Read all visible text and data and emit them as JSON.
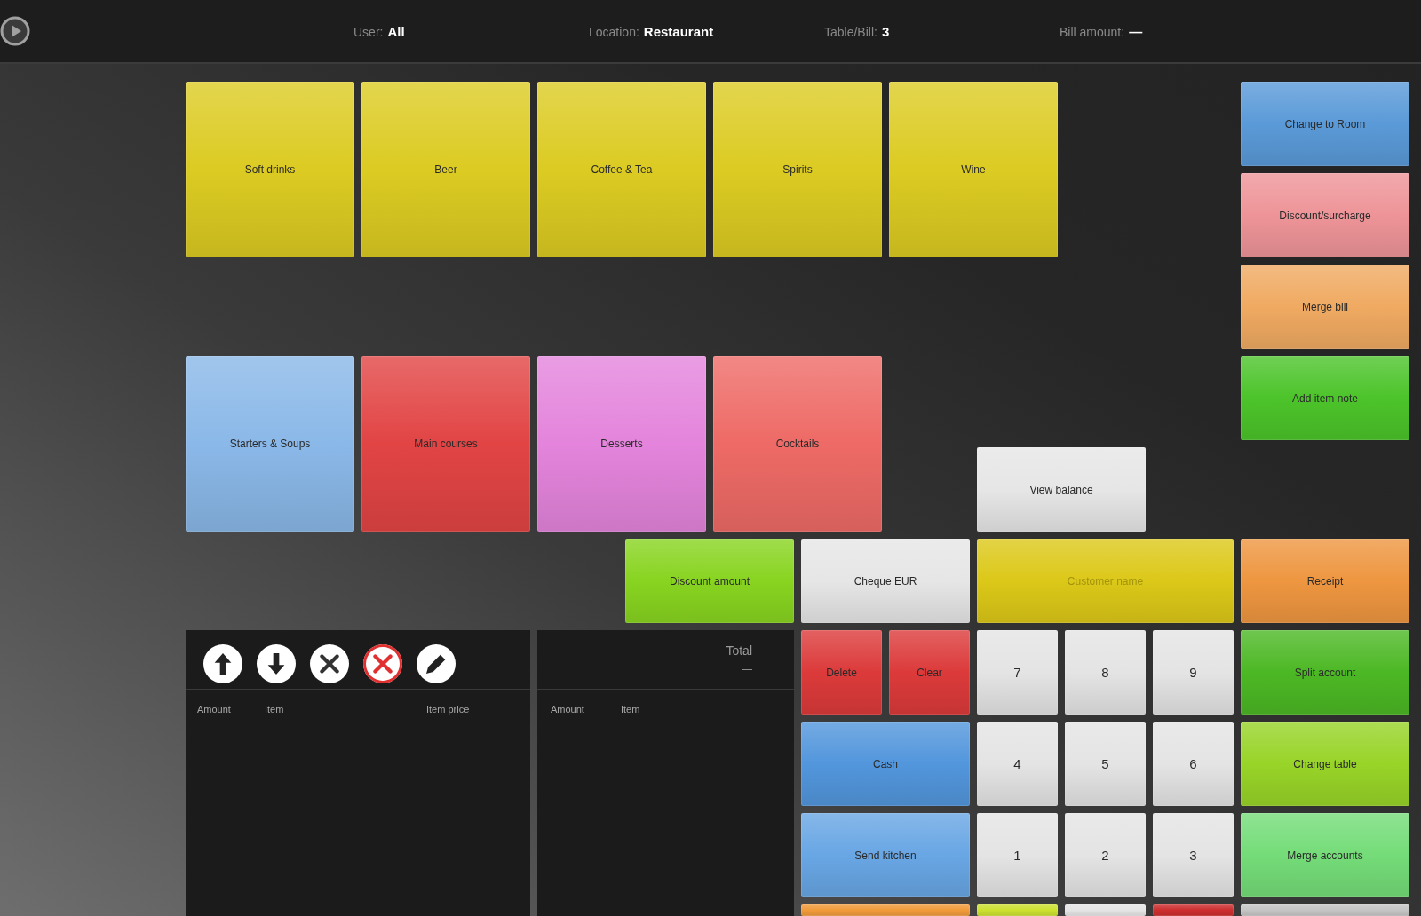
{
  "top_bar": {
    "info": [
      {
        "label": "User:",
        "value": "All"
      },
      {
        "label": "Location:",
        "value": "Restaurant"
      },
      {
        "label": "Table/Bill:",
        "value": "3"
      },
      {
        "label": "Bill amount:",
        "value": "—"
      }
    ]
  },
  "category_rows": [
    [
      {
        "label": "Soft drinks",
        "color": "#dccb22"
      },
      {
        "label": "Beer",
        "color": "#dccb22"
      },
      {
        "label": "Coffee & Tea",
        "color": "#dccb22"
      },
      {
        "label": "Spirits",
        "color": "#dccb22"
      },
      {
        "label": "Wine",
        "color": "#dccb22"
      }
    ],
    [
      {
        "label": "Starters & Soups",
        "color": "#8ab8e8"
      },
      {
        "label": "Main courses",
        "color": "#e24444"
      },
      {
        "label": "Desserts",
        "color": "#e484dc"
      },
      {
        "label": "Cocktails",
        "color": "#ee6a66"
      }
    ]
  ],
  "side_actions": [
    {
      "label": "Change to Room",
      "color": "#5a9ad8"
    },
    {
      "label": "Discount/surcharge",
      "color": "#ee9498"
    },
    {
      "label": "Merge bill",
      "color": "#f0aa62"
    },
    {
      "label": "Add item note",
      "color": "#4cc42a"
    }
  ],
  "actions": [
    {
      "label": "View balance",
      "color": "#e6e6e6",
      "disabled": false
    },
    {
      "label": "Discount amount",
      "color": "#88d420",
      "disabled": false
    },
    {
      "label": "Cheque EUR",
      "color": "#e6e6e6",
      "disabled": false
    },
    {
      "label": "Customer name",
      "color": "#dcc818",
      "disabled": true
    },
    {
      "label": "Receipt",
      "color": "#ee9640",
      "disabled": false
    }
  ],
  "payment_pad": [
    [
      {
        "kind": "action",
        "label": "Delete",
        "color": "#dc3a3a"
      },
      {
        "kind": "action",
        "label": "Clear",
        "color": "#dc3a3a"
      },
      {
        "kind": "digit",
        "label": "7",
        "color": "#e4e4e4"
      },
      {
        "kind": "digit",
        "label": "8",
        "color": "#e4e4e4"
      },
      {
        "kind": "digit",
        "label": "9",
        "color": "#e4e4e4"
      },
      {
        "kind": "action",
        "label": "Split account",
        "color": "#4cb824"
      }
    ],
    [
      {
        "kind": "action",
        "label": "Cash",
        "color": "#5296dc"
      },
      {
        "kind": "digit",
        "label": "4",
        "color": "#e4e4e4"
      },
      {
        "kind": "digit",
        "label": "5",
        "color": "#e4e4e4"
      },
      {
        "kind": "digit",
        "label": "6",
        "color": "#e4e4e4"
      },
      {
        "kind": "action",
        "label": "Change table",
        "color": "#98d428"
      }
    ],
    [
      {
        "kind": "action",
        "label": "Send kitchen",
        "color": "#68a6e4"
      },
      {
        "kind": "digit",
        "label": "1",
        "color": "#e4e4e4"
      },
      {
        "kind": "digit",
        "label": "2",
        "color": "#e4e4e4"
      },
      {
        "kind": "digit",
        "label": "3",
        "color": "#e4e4e4"
      },
      {
        "kind": "action",
        "label": "Merge accounts",
        "color": "#74dc78"
      }
    ],
    [
      {
        "color": "#f09a3a"
      },
      {
        "color": "#cce030"
      },
      {
        "color": "#e4e4e4"
      },
      {
        "color": "#cc2e2e"
      },
      {
        "color": "#c4c4c4"
      }
    ]
  ],
  "bill": {
    "toolbar": [
      {
        "kind": "up"
      },
      {
        "kind": "down"
      },
      {
        "kind": "remove"
      },
      {
        "kind": "delete"
      },
      {
        "kind": "edit"
      }
    ],
    "columns": [
      "Amount",
      "Item",
      "Item price"
    ]
  },
  "totals": {
    "label": "Total",
    "value": "—",
    "columns": [
      "Amount",
      "Item"
    ]
  }
}
